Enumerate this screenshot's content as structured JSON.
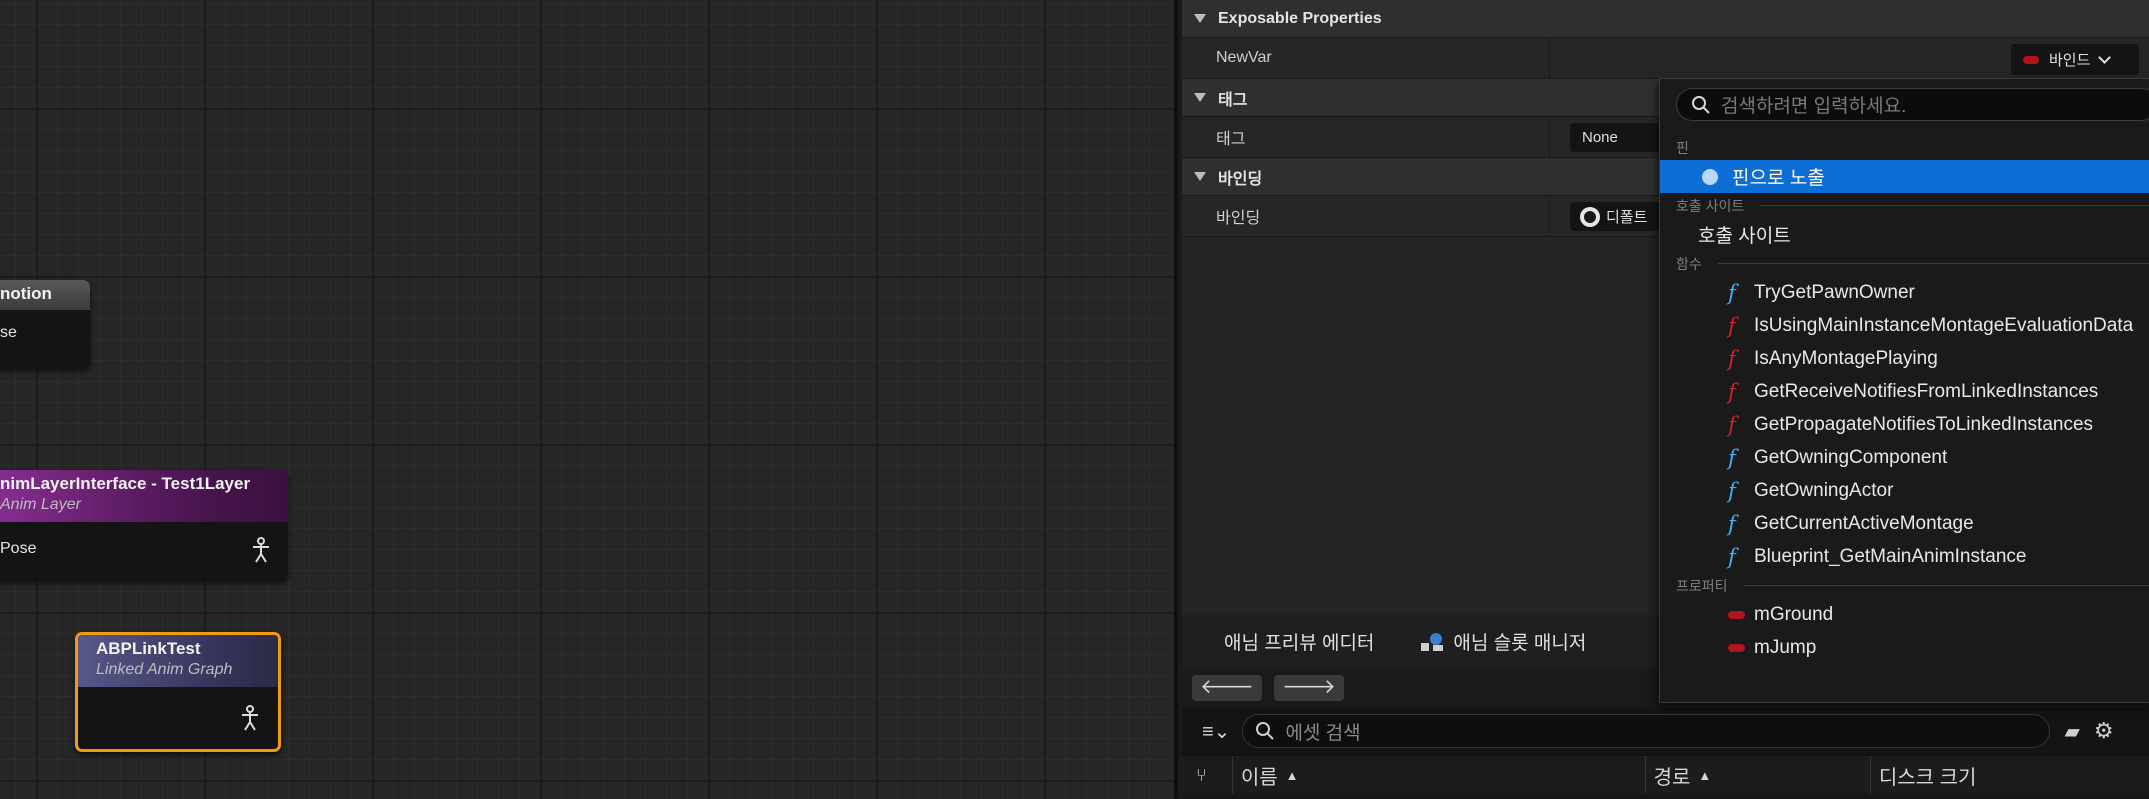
{
  "graph": {
    "node1": {
      "title": "notion",
      "pin": "se"
    },
    "node2": {
      "title": "nimLayerInterface - Test1Layer",
      "subtitle": "Anim Layer",
      "pin": "Pose"
    },
    "node3": {
      "title": "ABPLinkTest",
      "subtitle": "Linked Anim Graph"
    }
  },
  "details": {
    "sections": [
      {
        "title": "Exposable Properties",
        "row_key": "NewVar",
        "button_label": "바인드"
      },
      {
        "title": "태그",
        "row_key": "태그",
        "combo_value": "None"
      },
      {
        "title": "바인딩",
        "row_key": "바인딩",
        "combo_value": "디폴트"
      }
    ]
  },
  "popup": {
    "search_placeholder": "검색하려면 입력하세요.",
    "cat_pin": "핀",
    "selected_item": "핀으로 노출",
    "cat_callsite": "호출 사이트",
    "callsite_item": "호출 사이트",
    "cat_functions": "함수",
    "functions": [
      {
        "label": "TryGetPawnOwner",
        "color": "#3ab3f2"
      },
      {
        "label": "IsUsingMainInstanceMontageEvaluationData",
        "color": "#d2232a"
      },
      {
        "label": "IsAnyMontagePlaying",
        "color": "#d2232a"
      },
      {
        "label": "GetReceiveNotifiesFromLinkedInstances",
        "color": "#d2232a"
      },
      {
        "label": "GetPropagateNotifiesToLinkedInstances",
        "color": "#d2232a"
      },
      {
        "label": "GetOwningComponent",
        "color": "#3ab3f2"
      },
      {
        "label": "GetOwningActor",
        "color": "#3ab3f2"
      },
      {
        "label": "GetCurrentActiveMontage",
        "color": "#3ab3f2"
      },
      {
        "label": "Blueprint_GetMainAnimInstance",
        "color": "#3ab3f2"
      }
    ],
    "cat_properties": "프로퍼티",
    "properties": [
      "mGround",
      "mJump"
    ]
  },
  "lower": {
    "tabs": [
      "애님 프리뷰 에디터",
      "애님 슬롯 매니저"
    ],
    "search_placeholder": "에셋 검색",
    "columns": [
      "이름",
      "경로",
      "디스크 크기"
    ]
  }
}
